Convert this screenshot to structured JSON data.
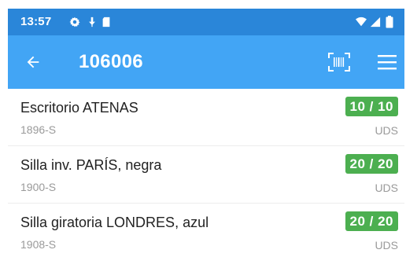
{
  "status_bar": {
    "time": "13:57",
    "icons": [
      "gear-icon",
      "download-icon",
      "sd-card-icon",
      "wifi-icon",
      "signal-icon",
      "battery-icon"
    ]
  },
  "app_bar": {
    "title": "106006",
    "background": "#42a5f5",
    "status_background": "#2a86d9",
    "icons": [
      "arrow-back-icon",
      "barcode-scan-icon",
      "menu-icon"
    ]
  },
  "items": [
    {
      "name": "Escritorio ATENAS",
      "code": "1896-S",
      "quantity": "10 / 10",
      "unit": "UDS"
    },
    {
      "name": "Silla inv. PARÍS, negra",
      "code": "1900-S",
      "quantity": "20 / 20",
      "unit": "UDS"
    },
    {
      "name": "Silla giratoria LONDRES, azul",
      "code": "1908-S",
      "quantity": "20 / 20",
      "unit": "UDS"
    }
  ],
  "colors": {
    "badge": "#4caf50"
  }
}
